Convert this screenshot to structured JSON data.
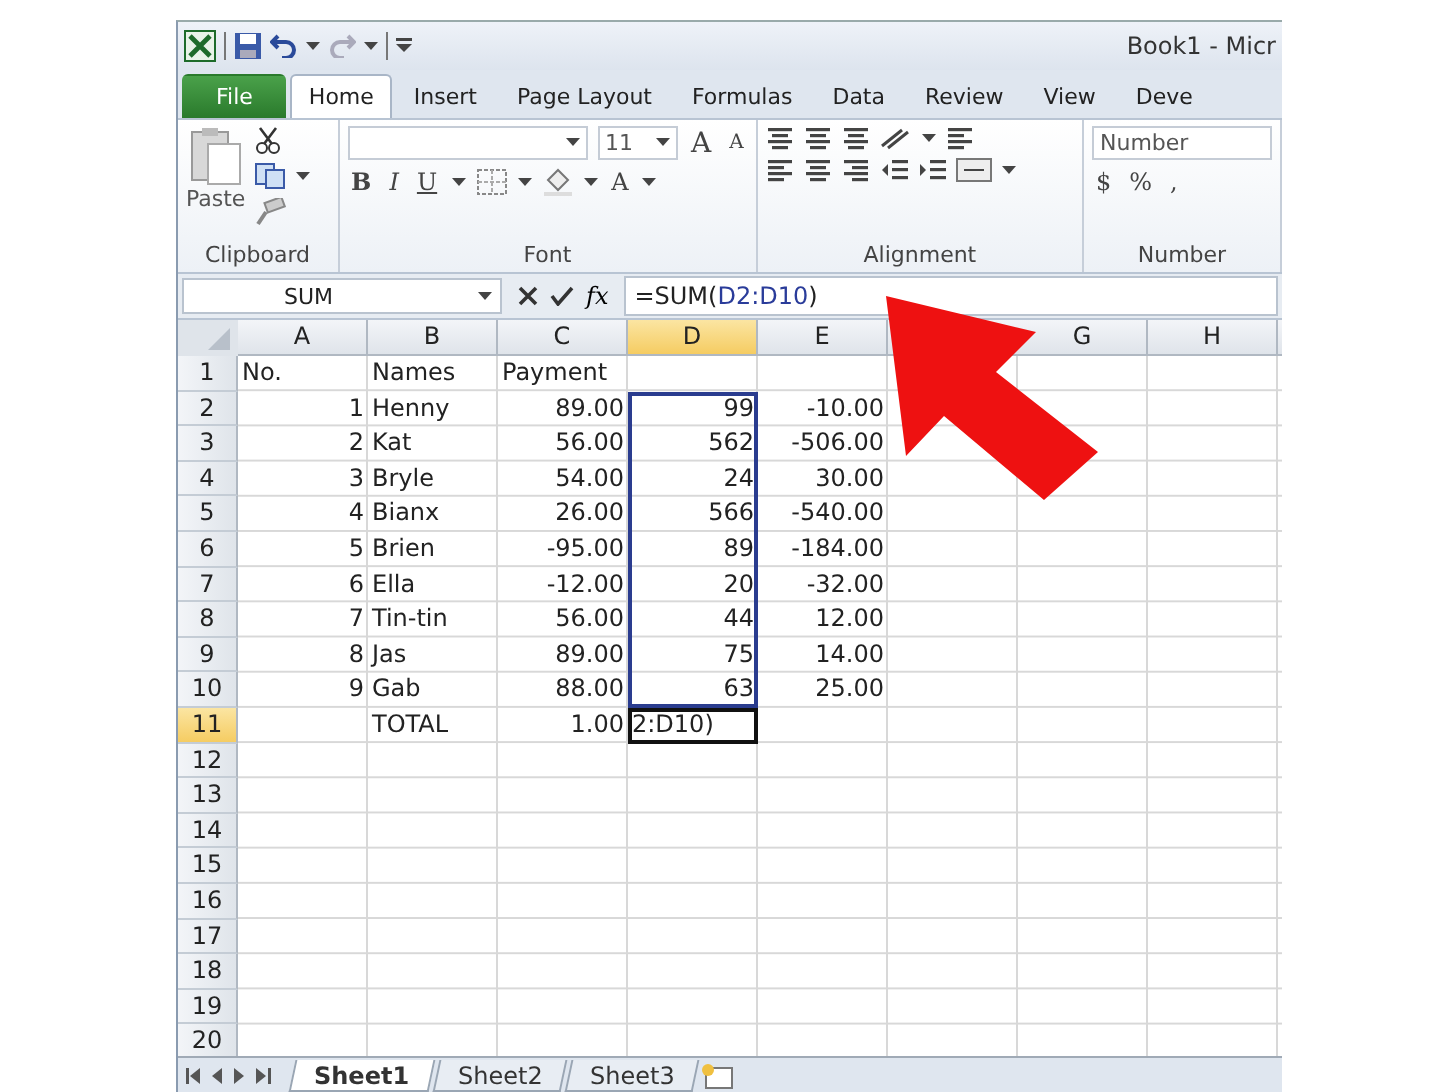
{
  "title_bar": {
    "title": "Book1  -  Micr"
  },
  "tabs": [
    {
      "label": "File",
      "kind": "file",
      "selected": false
    },
    {
      "label": "Home",
      "kind": "tab",
      "selected": true
    },
    {
      "label": "Insert",
      "kind": "tab",
      "selected": false
    },
    {
      "label": "Page Layout",
      "kind": "tab",
      "selected": false
    },
    {
      "label": "Formulas",
      "kind": "tab",
      "selected": false
    },
    {
      "label": "Data",
      "kind": "tab",
      "selected": false
    },
    {
      "label": "Review",
      "kind": "tab",
      "selected": false
    },
    {
      "label": "View",
      "kind": "tab",
      "selected": false
    },
    {
      "label": "Deve",
      "kind": "tab",
      "selected": false
    }
  ],
  "ribbon": {
    "clipboard": {
      "paste": "Paste",
      "label": "Clipboard"
    },
    "font": {
      "size": "11",
      "grow": "A",
      "shrink": "A",
      "styles": [
        "B",
        "I",
        "U"
      ],
      "text_color": "A",
      "label": "Font"
    },
    "alignment": {
      "label": "Alignment"
    },
    "number": {
      "format": "Number",
      "symbols": [
        "$",
        "%",
        ","
      ],
      "label": "Number"
    }
  },
  "formula_bar": {
    "name_box": "SUM",
    "fx": "fx",
    "formula": [
      {
        "text": "=SUM(",
        "kind": "plain"
      },
      {
        "text": "D2:D10",
        "kind": "ref"
      },
      {
        "text": ")",
        "kind": "plain"
      }
    ]
  },
  "columns": [
    {
      "label": "A",
      "selected": false
    },
    {
      "label": "B",
      "selected": false
    },
    {
      "label": "C",
      "selected": false
    },
    {
      "label": "D",
      "selected": true
    },
    {
      "label": "E",
      "selected": false
    },
    {
      "selected": false
    },
    {
      "label": "G",
      "selected": false
    },
    {
      "label": "H",
      "selected": false
    }
  ],
  "rows": [
    {
      "label": "1",
      "selected": false,
      "cells": [
        {
          "text": "No.",
          "kind": "text",
          "selected": false,
          "active": false
        },
        {
          "text": "Names",
          "kind": "text",
          "selected": false,
          "active": false
        },
        {
          "text": "Payment",
          "kind": "text",
          "selected": false,
          "active": false
        },
        null,
        null,
        null,
        null,
        null
      ]
    },
    {
      "label": "2",
      "selected": false,
      "cells": [
        {
          "text": "1",
          "kind": "number",
          "selected": false,
          "active": false
        },
        {
          "text": "Henny",
          "kind": "text",
          "selected": false,
          "active": false
        },
        {
          "text": "89.00",
          "kind": "number",
          "selected": false,
          "active": false
        },
        {
          "text": "99",
          "kind": "number",
          "selected": true,
          "active": false
        },
        {
          "text": "-10.00",
          "kind": "number",
          "selected": false,
          "active": false
        },
        null,
        null,
        null
      ]
    },
    {
      "label": "3",
      "selected": false,
      "cells": [
        {
          "text": "2",
          "kind": "number",
          "selected": false,
          "active": false
        },
        {
          "text": "Kat",
          "kind": "text",
          "selected": false,
          "active": false
        },
        {
          "text": "56.00",
          "kind": "number",
          "selected": false,
          "active": false
        },
        {
          "text": "562",
          "kind": "number",
          "selected": true,
          "active": false
        },
        {
          "text": "-506.00",
          "kind": "number",
          "selected": false,
          "active": false
        },
        null,
        null,
        null
      ]
    },
    {
      "label": "4",
      "selected": false,
      "cells": [
        {
          "text": "3",
          "kind": "number",
          "selected": false,
          "active": false
        },
        {
          "text": "Bryle",
          "kind": "text",
          "selected": false,
          "active": false
        },
        {
          "text": "54.00",
          "kind": "number",
          "selected": false,
          "active": false
        },
        {
          "text": "24",
          "kind": "number",
          "selected": true,
          "active": false
        },
        {
          "text": "30.00",
          "kind": "number",
          "selected": false,
          "active": false
        },
        null,
        null,
        null
      ]
    },
    {
      "label": "5",
      "selected": false,
      "cells": [
        {
          "text": "4",
          "kind": "number",
          "selected": false,
          "active": false
        },
        {
          "text": "Bianx",
          "kind": "text",
          "selected": false,
          "active": false
        },
        {
          "text": "26.00",
          "kind": "number",
          "selected": false,
          "active": false
        },
        {
          "text": "566",
          "kind": "number",
          "selected": true,
          "active": false
        },
        {
          "text": "-540.00",
          "kind": "number",
          "selected": false,
          "active": false
        },
        null,
        null,
        null
      ]
    },
    {
      "label": "6",
      "selected": false,
      "cells": [
        {
          "text": "5",
          "kind": "number",
          "selected": false,
          "active": false
        },
        {
          "text": "Brien",
          "kind": "text",
          "selected": false,
          "active": false
        },
        {
          "text": "-95.00",
          "kind": "number",
          "selected": false,
          "active": false
        },
        {
          "text": "89",
          "kind": "number",
          "selected": true,
          "active": false
        },
        {
          "text": "-184.00",
          "kind": "number",
          "selected": false,
          "active": false
        },
        null,
        null,
        null
      ]
    },
    {
      "label": "7",
      "selected": false,
      "cells": [
        {
          "text": "6",
          "kind": "number",
          "selected": false,
          "active": false
        },
        {
          "text": "Ella",
          "kind": "text",
          "selected": false,
          "active": false
        },
        {
          "text": "-12.00",
          "kind": "number",
          "selected": false,
          "active": false
        },
        {
          "text": "20",
          "kind": "number",
          "selected": true,
          "active": false
        },
        {
          "text": "-32.00",
          "kind": "number",
          "selected": false,
          "active": false
        },
        null,
        null,
        null
      ]
    },
    {
      "label": "8",
      "selected": false,
      "cells": [
        {
          "text": "7",
          "kind": "number",
          "selected": false,
          "active": false
        },
        {
          "text": "Tin-tin",
          "kind": "text",
          "selected": false,
          "active": false
        },
        {
          "text": "56.00",
          "kind": "number",
          "selected": false,
          "active": false
        },
        {
          "text": "44",
          "kind": "number",
          "selected": true,
          "active": false
        },
        {
          "text": "12.00",
          "kind": "number",
          "selected": false,
          "active": false
        },
        null,
        null,
        null
      ]
    },
    {
      "label": "9",
      "selected": false,
      "cells": [
        {
          "text": "8",
          "kind": "number",
          "selected": false,
          "active": false
        },
        {
          "text": "Jas",
          "kind": "text",
          "selected": false,
          "active": false
        },
        {
          "text": "89.00",
          "kind": "number",
          "selected": false,
          "active": false
        },
        {
          "text": "75",
          "kind": "number",
          "selected": true,
          "active": false
        },
        {
          "text": "14.00",
          "kind": "number",
          "selected": false,
          "active": false
        },
        null,
        null,
        null
      ]
    },
    {
      "label": "10",
      "selected": false,
      "cells": [
        {
          "text": "9",
          "kind": "number",
          "selected": false,
          "active": false
        },
        {
          "text": "Gab",
          "kind": "text",
          "selected": false,
          "active": false
        },
        {
          "text": "88.00",
          "kind": "number",
          "selected": false,
          "active": false
        },
        {
          "text": "63",
          "kind": "number",
          "selected": true,
          "active": false
        },
        {
          "text": "25.00",
          "kind": "number",
          "selected": false,
          "active": false
        },
        null,
        null,
        null
      ]
    },
    {
      "label": "11",
      "selected": true,
      "cells": [
        null,
        {
          "text": "TOTAL",
          "kind": "text",
          "selected": false,
          "active": false
        },
        {
          "text": "1.00",
          "kind": "number",
          "selected": false,
          "active": false
        },
        {
          "text": "2:D10)",
          "kind": "text",
          "selected": false,
          "active": true
        },
        null,
        null,
        null,
        null
      ]
    },
    {
      "label": "12",
      "selected": false
    },
    {
      "label": "13",
      "selected": false
    },
    {
      "label": "14",
      "selected": false
    },
    {
      "label": "15",
      "selected": false
    },
    {
      "label": "16",
      "selected": false
    },
    {
      "label": "17",
      "selected": false
    },
    {
      "label": "18",
      "selected": false
    },
    {
      "label": "19",
      "selected": false
    },
    {
      "label": "20",
      "selected": false
    }
  ],
  "sheet_tabs": [
    {
      "label": "Sheet1",
      "selected": true
    },
    {
      "label": "Sheet2",
      "selected": false
    },
    {
      "label": "Sheet3",
      "selected": false
    }
  ]
}
